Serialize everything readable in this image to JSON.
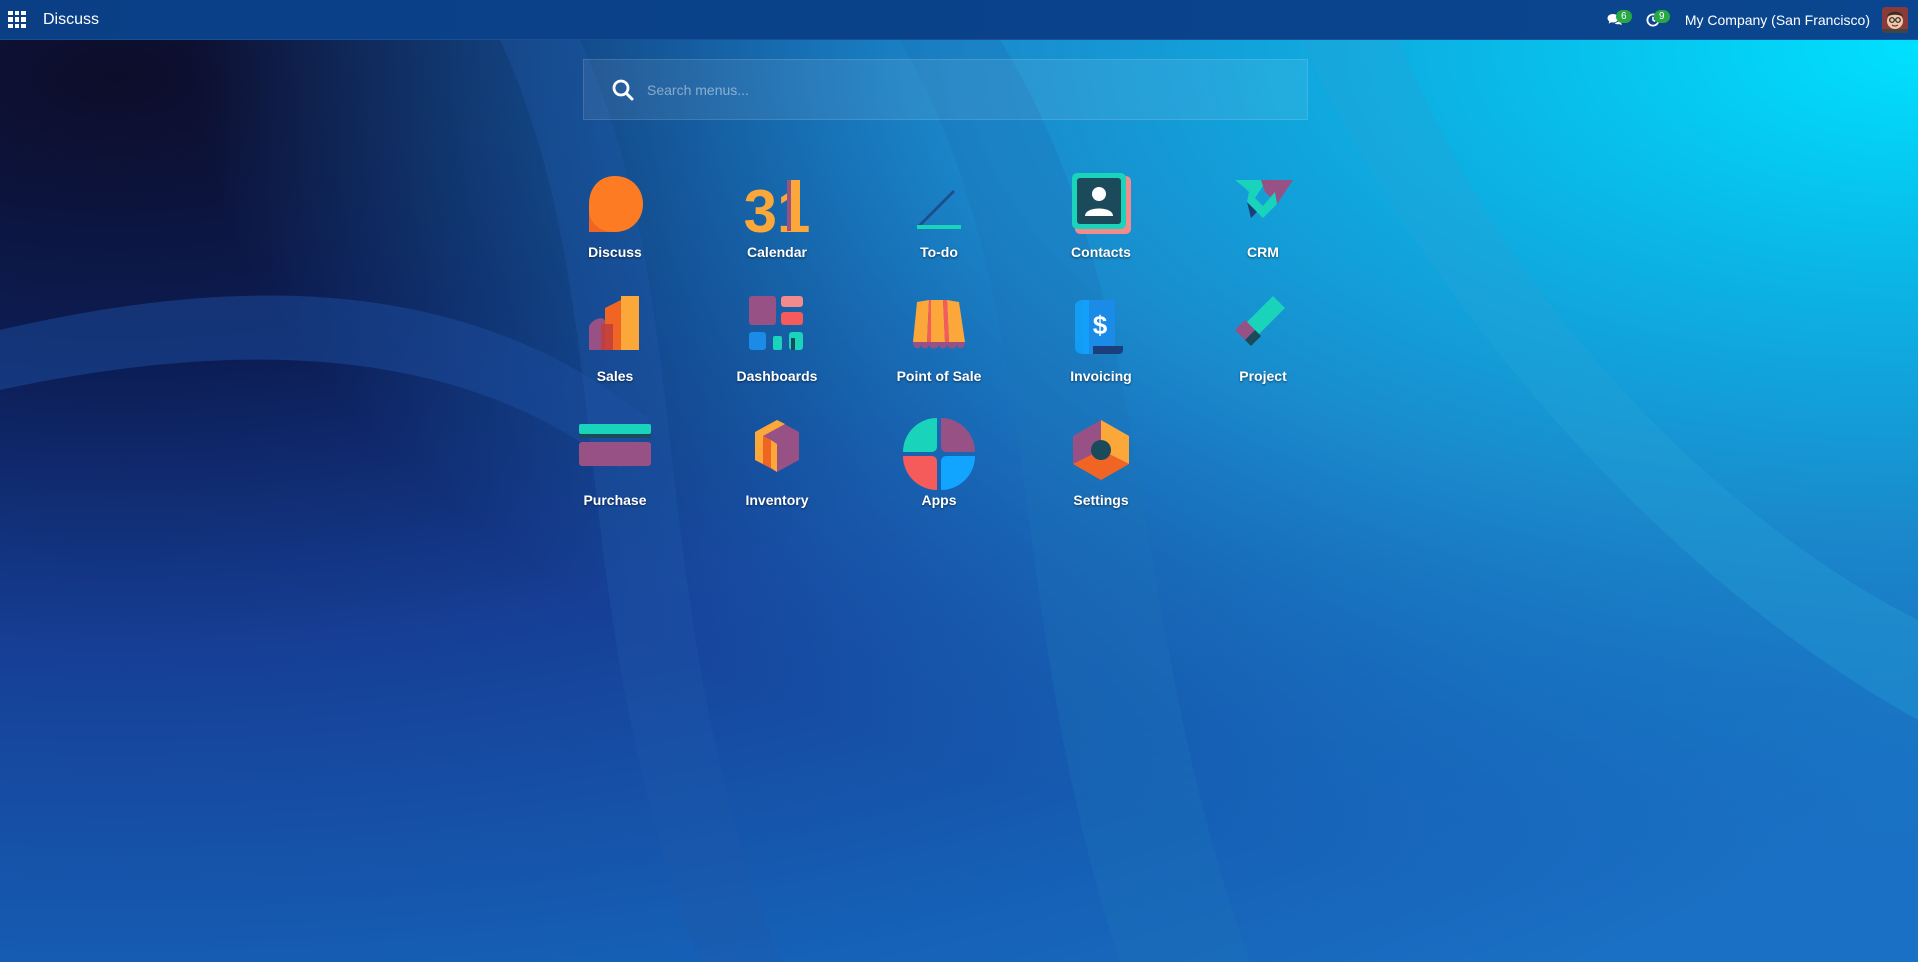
{
  "navbar": {
    "app_title": "Discuss",
    "messages_badge": "6",
    "activities_badge": "9",
    "company": "My Company (San Francisco)"
  },
  "search": {
    "placeholder": "Search menus..."
  },
  "apps": [
    {
      "label": "Discuss",
      "icon": "discuss-icon"
    },
    {
      "label": "Calendar",
      "icon": "calendar-icon"
    },
    {
      "label": "To-do",
      "icon": "todo-icon"
    },
    {
      "label": "Contacts",
      "icon": "contacts-icon"
    },
    {
      "label": "CRM",
      "icon": "crm-icon"
    },
    {
      "label": "Sales",
      "icon": "sales-icon"
    },
    {
      "label": "Dashboards",
      "icon": "dashboards-icon"
    },
    {
      "label": "Point of Sale",
      "icon": "point-of-sale-icon"
    },
    {
      "label": "Invoicing",
      "icon": "invoicing-icon"
    },
    {
      "label": "Project",
      "icon": "project-icon"
    },
    {
      "label": "Purchase",
      "icon": "purchase-icon"
    },
    {
      "label": "Inventory",
      "icon": "inventory-icon"
    },
    {
      "label": "Apps",
      "icon": "apps-icon"
    },
    {
      "label": "Settings",
      "icon": "settings-icon"
    }
  ],
  "icon_text": {
    "calendar_day": "31",
    "invoicing_symbol": "$"
  },
  "colors": {
    "navbar": "#0a468f",
    "badge": "#28a745",
    "orange": "#fc7b23",
    "purple": "#985184",
    "teal": "#1ad3bb",
    "red": "#f55b5b",
    "blue": "#1a8be7"
  }
}
